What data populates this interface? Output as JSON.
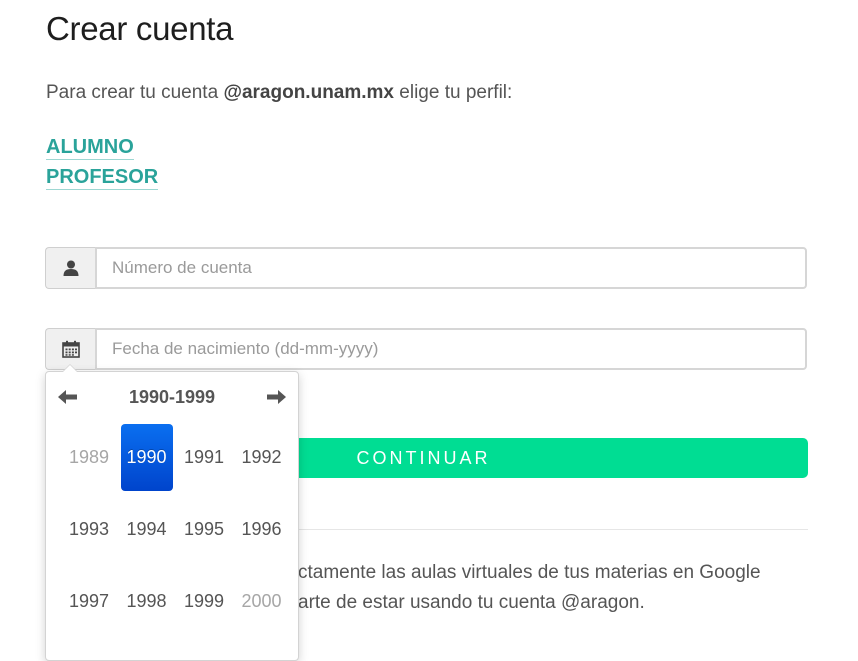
{
  "page": {
    "title": "Crear cuenta",
    "intro_prefix": "Para crear tu cuenta ",
    "intro_domain": "@aragon.unam.mx",
    "intro_suffix": " elige tu perfil:"
  },
  "profiles": [
    "ALUMNO",
    "PROFESOR"
  ],
  "form": {
    "account_placeholder": "Número de cuenta",
    "birthdate_placeholder": "Fecha de nacimiento (dd-mm-yyyy)",
    "continue_label": "CONTINUAR"
  },
  "note": {
    "line1": "ctamente las aulas virtuales de tus materias en Google",
    "line2": "arte de estar usando tu cuenta @aragon."
  },
  "datepicker": {
    "decade": "1990-1999",
    "years": [
      {
        "label": "1989",
        "state": "old"
      },
      {
        "label": "1990",
        "state": "active"
      },
      {
        "label": "1991",
        "state": "normal"
      },
      {
        "label": "1992",
        "state": "normal"
      },
      {
        "label": "1993",
        "state": "normal"
      },
      {
        "label": "1994",
        "state": "normal"
      },
      {
        "label": "1995",
        "state": "normal"
      },
      {
        "label": "1996",
        "state": "normal"
      },
      {
        "label": "1997",
        "state": "normal"
      },
      {
        "label": "1998",
        "state": "normal"
      },
      {
        "label": "1999",
        "state": "normal"
      },
      {
        "label": "2000",
        "state": "old"
      }
    ]
  },
  "icons": {
    "account": "user-icon",
    "birthdate": "calendar-icon",
    "prev": "arrow-left-icon",
    "next": "arrow-right-icon"
  },
  "colors": {
    "link": "#2aa39a",
    "button": "#00dd93",
    "active_year": "#0044cc"
  }
}
